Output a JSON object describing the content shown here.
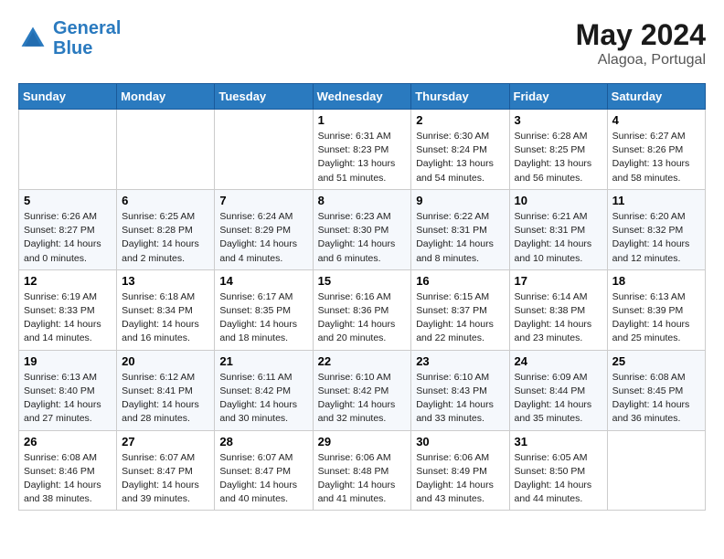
{
  "header": {
    "logo_line1": "General",
    "logo_line2": "Blue",
    "month": "May 2024",
    "location": "Alagoa, Portugal"
  },
  "weekdays": [
    "Sunday",
    "Monday",
    "Tuesday",
    "Wednesday",
    "Thursday",
    "Friday",
    "Saturday"
  ],
  "weeks": [
    [
      {
        "day": "",
        "info": ""
      },
      {
        "day": "",
        "info": ""
      },
      {
        "day": "",
        "info": ""
      },
      {
        "day": "1",
        "info": "Sunrise: 6:31 AM\nSunset: 8:23 PM\nDaylight: 13 hours\nand 51 minutes."
      },
      {
        "day": "2",
        "info": "Sunrise: 6:30 AM\nSunset: 8:24 PM\nDaylight: 13 hours\nand 54 minutes."
      },
      {
        "day": "3",
        "info": "Sunrise: 6:28 AM\nSunset: 8:25 PM\nDaylight: 13 hours\nand 56 minutes."
      },
      {
        "day": "4",
        "info": "Sunrise: 6:27 AM\nSunset: 8:26 PM\nDaylight: 13 hours\nand 58 minutes."
      }
    ],
    [
      {
        "day": "5",
        "info": "Sunrise: 6:26 AM\nSunset: 8:27 PM\nDaylight: 14 hours\nand 0 minutes."
      },
      {
        "day": "6",
        "info": "Sunrise: 6:25 AM\nSunset: 8:28 PM\nDaylight: 14 hours\nand 2 minutes."
      },
      {
        "day": "7",
        "info": "Sunrise: 6:24 AM\nSunset: 8:29 PM\nDaylight: 14 hours\nand 4 minutes."
      },
      {
        "day": "8",
        "info": "Sunrise: 6:23 AM\nSunset: 8:30 PM\nDaylight: 14 hours\nand 6 minutes."
      },
      {
        "day": "9",
        "info": "Sunrise: 6:22 AM\nSunset: 8:31 PM\nDaylight: 14 hours\nand 8 minutes."
      },
      {
        "day": "10",
        "info": "Sunrise: 6:21 AM\nSunset: 8:31 PM\nDaylight: 14 hours\nand 10 minutes."
      },
      {
        "day": "11",
        "info": "Sunrise: 6:20 AM\nSunset: 8:32 PM\nDaylight: 14 hours\nand 12 minutes."
      }
    ],
    [
      {
        "day": "12",
        "info": "Sunrise: 6:19 AM\nSunset: 8:33 PM\nDaylight: 14 hours\nand 14 minutes."
      },
      {
        "day": "13",
        "info": "Sunrise: 6:18 AM\nSunset: 8:34 PM\nDaylight: 14 hours\nand 16 minutes."
      },
      {
        "day": "14",
        "info": "Sunrise: 6:17 AM\nSunset: 8:35 PM\nDaylight: 14 hours\nand 18 minutes."
      },
      {
        "day": "15",
        "info": "Sunrise: 6:16 AM\nSunset: 8:36 PM\nDaylight: 14 hours\nand 20 minutes."
      },
      {
        "day": "16",
        "info": "Sunrise: 6:15 AM\nSunset: 8:37 PM\nDaylight: 14 hours\nand 22 minutes."
      },
      {
        "day": "17",
        "info": "Sunrise: 6:14 AM\nSunset: 8:38 PM\nDaylight: 14 hours\nand 23 minutes."
      },
      {
        "day": "18",
        "info": "Sunrise: 6:13 AM\nSunset: 8:39 PM\nDaylight: 14 hours\nand 25 minutes."
      }
    ],
    [
      {
        "day": "19",
        "info": "Sunrise: 6:13 AM\nSunset: 8:40 PM\nDaylight: 14 hours\nand 27 minutes."
      },
      {
        "day": "20",
        "info": "Sunrise: 6:12 AM\nSunset: 8:41 PM\nDaylight: 14 hours\nand 28 minutes."
      },
      {
        "day": "21",
        "info": "Sunrise: 6:11 AM\nSunset: 8:42 PM\nDaylight: 14 hours\nand 30 minutes."
      },
      {
        "day": "22",
        "info": "Sunrise: 6:10 AM\nSunset: 8:42 PM\nDaylight: 14 hours\nand 32 minutes."
      },
      {
        "day": "23",
        "info": "Sunrise: 6:10 AM\nSunset: 8:43 PM\nDaylight: 14 hours\nand 33 minutes."
      },
      {
        "day": "24",
        "info": "Sunrise: 6:09 AM\nSunset: 8:44 PM\nDaylight: 14 hours\nand 35 minutes."
      },
      {
        "day": "25",
        "info": "Sunrise: 6:08 AM\nSunset: 8:45 PM\nDaylight: 14 hours\nand 36 minutes."
      }
    ],
    [
      {
        "day": "26",
        "info": "Sunrise: 6:08 AM\nSunset: 8:46 PM\nDaylight: 14 hours\nand 38 minutes."
      },
      {
        "day": "27",
        "info": "Sunrise: 6:07 AM\nSunset: 8:47 PM\nDaylight: 14 hours\nand 39 minutes."
      },
      {
        "day": "28",
        "info": "Sunrise: 6:07 AM\nSunset: 8:47 PM\nDaylight: 14 hours\nand 40 minutes."
      },
      {
        "day": "29",
        "info": "Sunrise: 6:06 AM\nSunset: 8:48 PM\nDaylight: 14 hours\nand 41 minutes."
      },
      {
        "day": "30",
        "info": "Sunrise: 6:06 AM\nSunset: 8:49 PM\nDaylight: 14 hours\nand 43 minutes."
      },
      {
        "day": "31",
        "info": "Sunrise: 6:05 AM\nSunset: 8:50 PM\nDaylight: 14 hours\nand 44 minutes."
      },
      {
        "day": "",
        "info": ""
      }
    ]
  ]
}
